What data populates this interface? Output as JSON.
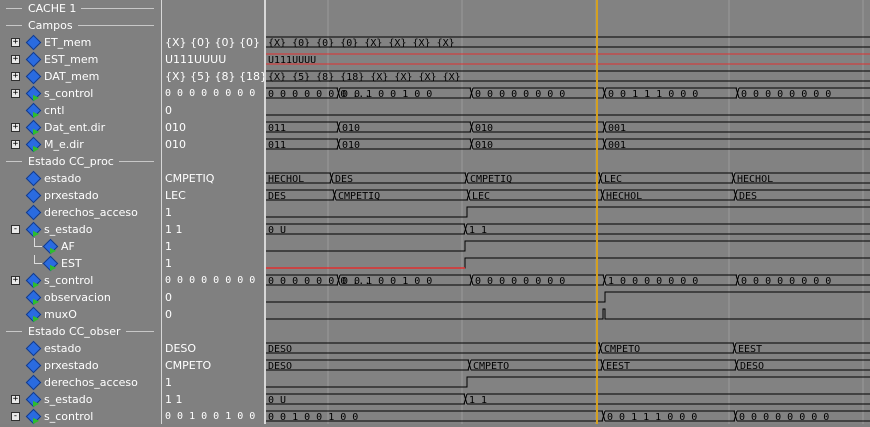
{
  "rows": [
    {
      "kind": "group",
      "name": "CACHE 1",
      "value": ""
    },
    {
      "kind": "group",
      "name": "Campos",
      "value": ""
    },
    {
      "kind": "signal",
      "name": "ET_mem",
      "value": "{X} {0} {0} {0} {...",
      "expand": "+",
      "icon": "bus",
      "indent": 0
    },
    {
      "kind": "signal",
      "name": "EST_mem",
      "value": "U111UUUU",
      "expand": "+",
      "icon": "bus",
      "indent": 0
    },
    {
      "kind": "signal",
      "name": "DAT_mem",
      "value": "{X} {5} {8} {18}...",
      "expand": "+",
      "icon": "bus",
      "indent": 0
    },
    {
      "kind": "signal",
      "name": "s_control",
      "value": "0 0 0 0 0 0 0 0",
      "expand": "+",
      "icon": "bus-arrow",
      "indent": 0
    },
    {
      "kind": "signal",
      "name": "cntl",
      "value": "0",
      "expand": "",
      "icon": "bit-arrow",
      "indent": 0
    },
    {
      "kind": "signal",
      "name": "Dat_ent.dir",
      "value": "010",
      "expand": "+",
      "icon": "bus-arrow",
      "indent": 0
    },
    {
      "kind": "signal",
      "name": "M_e.dir",
      "value": "010",
      "expand": "+",
      "icon": "bus-arrow",
      "indent": 0
    },
    {
      "kind": "group",
      "name": "Estado CC_proc",
      "value": ""
    },
    {
      "kind": "signal",
      "name": "estado",
      "value": "CMPETIQ",
      "expand": "",
      "icon": "bit",
      "indent": 0
    },
    {
      "kind": "signal",
      "name": "prxestado",
      "value": "LEC",
      "expand": "",
      "icon": "bit",
      "indent": 0
    },
    {
      "kind": "signal",
      "name": "derechos_acceso",
      "value": "1",
      "expand": "",
      "icon": "bit",
      "indent": 0
    },
    {
      "kind": "signal",
      "name": "s_estado",
      "value": "1 1",
      "expand": "-",
      "icon": "bus-arrow",
      "indent": 0
    },
    {
      "kind": "signal",
      "name": "AF",
      "value": "1",
      "expand": "",
      "icon": "bit-arrow",
      "indent": 1
    },
    {
      "kind": "signal",
      "name": "EST",
      "value": "1",
      "expand": "",
      "icon": "bit-arrow",
      "indent": 1
    },
    {
      "kind": "signal",
      "name": "s_control",
      "value": "0 0 0 0 0 0 0 0",
      "expand": "+",
      "icon": "bus-arrow",
      "indent": 0
    },
    {
      "kind": "signal",
      "name": "observacion",
      "value": "0",
      "expand": "",
      "icon": "bit-arrow",
      "indent": 0
    },
    {
      "kind": "signal",
      "name": "muxO",
      "value": "0",
      "expand": "",
      "icon": "bit-arrow",
      "indent": 0
    },
    {
      "kind": "group",
      "name": "Estado CC_obser",
      "value": ""
    },
    {
      "kind": "signal",
      "name": "estado",
      "value": "DESO",
      "expand": "",
      "icon": "bit",
      "indent": 0
    },
    {
      "kind": "signal",
      "name": "prxestado",
      "value": "CMPETO",
      "expand": "",
      "icon": "bit",
      "indent": 0
    },
    {
      "kind": "signal",
      "name": "derechos_acceso",
      "value": "1",
      "expand": "",
      "icon": "bit",
      "indent": 0
    },
    {
      "kind": "signal",
      "name": "s_estado",
      "value": "1 1",
      "expand": "+",
      "icon": "bus-arrow",
      "indent": 0
    },
    {
      "kind": "signal",
      "name": "s_control",
      "value": "0 0 1 0 0 1 0 0",
      "expand": "-",
      "icon": "bus-arrow",
      "indent": 0
    }
  ],
  "waves": [
    {
      "type": "none"
    },
    {
      "type": "none"
    },
    {
      "type": "bus",
      "segs": [
        {
          "s": 0,
          "label": "{X} {0} {0} {0} {X} {X} {X} {X}"
        }
      ]
    },
    {
      "type": "bus",
      "segs": [
        {
          "s": 0,
          "label": "U111UUUU"
        }
      ],
      "highlight": true
    },
    {
      "type": "bus",
      "segs": [
        {
          "s": 0,
          "label": "{X} {5} {8} {18} {X} {X} {X} {X}"
        }
      ]
    },
    {
      "type": "bus",
      "segs": [
        {
          "s": 0,
          "label": "0 0 0 0 0 0 0 ..."
        },
        {
          "s": 72,
          "label": "0 0 1 0 0 1 0 0"
        },
        {
          "s": 205,
          "label": "0 0 0 0 0 0 0 0"
        },
        {
          "s": 338,
          "label": "0 0 1 1 1 0 0 0"
        },
        {
          "s": 471,
          "label": "0 0 0 0 0 0 0 0"
        }
      ]
    },
    {
      "type": "bit",
      "levels": [
        {
          "s": 0,
          "v": 0
        }
      ]
    },
    {
      "type": "bus",
      "segs": [
        {
          "s": 0,
          "label": "011"
        },
        {
          "s": 72,
          "label": "010"
        },
        {
          "s": 205,
          "label": "010"
        },
        {
          "s": 338,
          "label": "001"
        }
      ]
    },
    {
      "type": "bus",
      "segs": [
        {
          "s": 0,
          "label": "011"
        },
        {
          "s": 72,
          "label": "010"
        },
        {
          "s": 205,
          "label": "010"
        },
        {
          "s": 338,
          "label": "001"
        }
      ]
    },
    {
      "type": "none"
    },
    {
      "type": "bus",
      "segs": [
        {
          "s": 0,
          "label": "HECHOL"
        },
        {
          "s": 65,
          "label": "DES"
        },
        {
          "s": 200,
          "label": "CMPETIQ"
        },
        {
          "s": 334,
          "label": "LEC"
        },
        {
          "s": 467,
          "label": "HECHOL"
        }
      ]
    },
    {
      "type": "bus",
      "segs": [
        {
          "s": 0,
          "label": "DES"
        },
        {
          "s": 68,
          "label": "CMPETIQ"
        },
        {
          "s": 202,
          "label": "LEC"
        },
        {
          "s": 336,
          "label": "HECHOL"
        },
        {
          "s": 469,
          "label": "DES"
        }
      ]
    },
    {
      "type": "bit",
      "levels": [
        {
          "s": 0,
          "v": 0
        },
        {
          "s": 201,
          "v": 1
        }
      ]
    },
    {
      "type": "bus",
      "segs": [
        {
          "s": 0,
          "label": "0 U"
        },
        {
          "s": 199,
          "label": "1 1"
        }
      ]
    },
    {
      "type": "bit",
      "levels": [
        {
          "s": 0,
          "v": 0
        },
        {
          "s": 199,
          "v": 1
        }
      ]
    },
    {
      "type": "bit",
      "levels": [
        {
          "s": 0,
          "v": 0
        },
        {
          "s": 199,
          "v": 1
        }
      ],
      "redlow": true
    },
    {
      "type": "bus",
      "segs": [
        {
          "s": 0,
          "label": "0 0 0 0 0 0 0 ..."
        },
        {
          "s": 72,
          "label": "0 0 1 0 0 1 0 0"
        },
        {
          "s": 205,
          "label": "0 0 0 0 0 0 0 0"
        },
        {
          "s": 338,
          "label": "1 0 0 0 0 0 0 0"
        },
        {
          "s": 471,
          "label": "0 0 0 0 0 0 0 0"
        }
      ]
    },
    {
      "type": "bit",
      "levels": [
        {
          "s": 0,
          "v": 0
        },
        {
          "s": 339,
          "v": 1
        }
      ]
    },
    {
      "type": "bit",
      "levels": [
        {
          "s": 0,
          "v": 0
        },
        {
          "s": 337,
          "v": 1
        },
        {
          "s": 339,
          "v": 0
        }
      ]
    },
    {
      "type": "none"
    },
    {
      "type": "bus",
      "segs": [
        {
          "s": 0,
          "label": "DESO"
        },
        {
          "s": 334,
          "label": "CMPETO"
        },
        {
          "s": 468,
          "label": "EEST"
        }
      ]
    },
    {
      "type": "bus",
      "segs": [
        {
          "s": 0,
          "label": "DESO"
        },
        {
          "s": 203,
          "label": "CMPETO"
        },
        {
          "s": 336,
          "label": "EEST"
        },
        {
          "s": 470,
          "label": "DESO"
        }
      ]
    },
    {
      "type": "bit",
      "levels": [
        {
          "s": 0,
          "v": 0
        },
        {
          "s": 201,
          "v": 1
        }
      ]
    },
    {
      "type": "bus",
      "segs": [
        {
          "s": 0,
          "label": "0 U"
        },
        {
          "s": 199,
          "label": "1 1"
        }
      ]
    },
    {
      "type": "bus",
      "segs": [
        {
          "s": 0,
          "label": "0 0 1 0 0 1 0 0"
        },
        {
          "s": 337,
          "label": "0 0 1 1 1 0 0 0"
        },
        {
          "s": 469,
          "label": "0 0 0 0 0 0 0 0"
        }
      ]
    }
  ],
  "colors": {
    "trace": "#000000",
    "bit_low": "#ffffff",
    "red": "#e03030",
    "cursor": "#d4a020",
    "grid": "#9a9a9a"
  }
}
